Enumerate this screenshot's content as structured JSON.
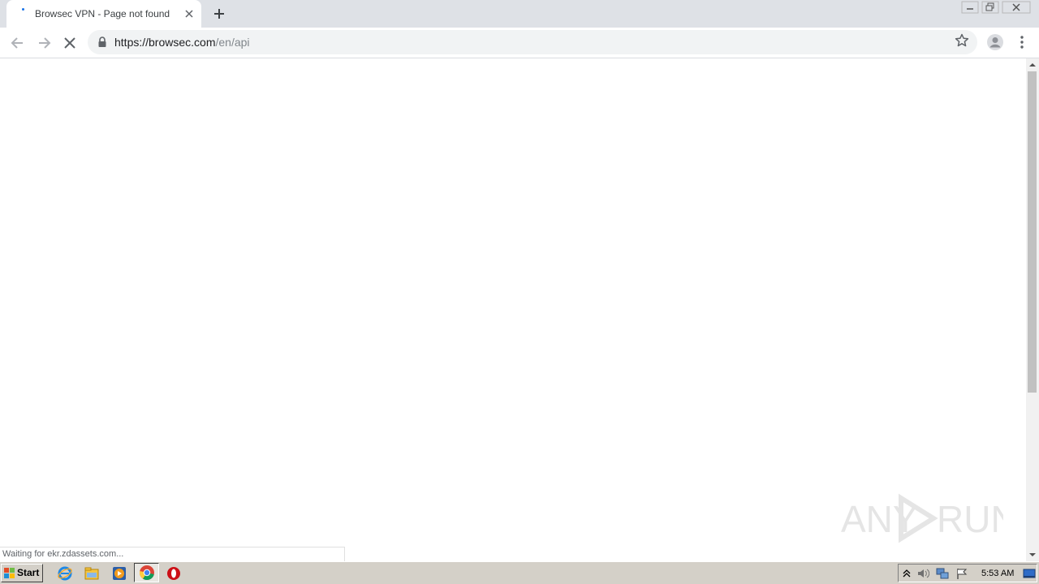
{
  "browser": {
    "tab": {
      "title": "Browsec VPN - Page not found",
      "close_icon": "close-icon"
    },
    "new_tab_icon": "plus-icon",
    "window_controls": [
      "minimize-icon",
      "restore-icon",
      "close-icon"
    ],
    "url": {
      "host": "https://browsec.com",
      "path": "/en/api"
    },
    "status_text": "Waiting for ekr.zdassets.com..."
  },
  "watermark": {
    "text_left": "ANY",
    "text_right": "RUN"
  },
  "taskbar": {
    "start_label": "Start",
    "pinned": [
      "internet-explorer-icon",
      "file-explorer-icon",
      "media-player-icon",
      "chrome-icon",
      "opera-icon"
    ],
    "clock": "5:53 AM"
  },
  "colors": {
    "accent": "#1a73e8",
    "tabstrip": "#dee1e6",
    "taskbar": "#d4d0c8"
  }
}
